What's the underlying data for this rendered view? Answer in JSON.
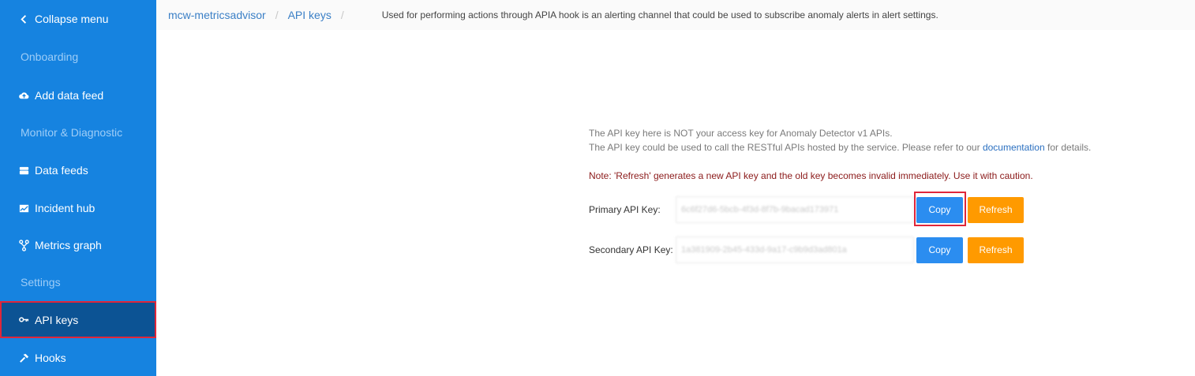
{
  "sidebar": {
    "collapse_label": "Collapse menu",
    "sections": {
      "onboarding": "Onboarding",
      "monitor": "Monitor & Diagnostic",
      "settings": "Settings"
    },
    "items": {
      "add_data_feed": "Add data feed",
      "data_feeds": "Data feeds",
      "incident_hub": "Incident hub",
      "metrics_graph": "Metrics graph",
      "api_keys": "API keys",
      "hooks": "Hooks"
    }
  },
  "header": {
    "breadcrumb_root": "mcw-metricsadvisor",
    "breadcrumb_current": "API keys",
    "description": "Used for performing actions through APIA hook is an alerting channel that could be used to subscribe anomaly alerts in alert settings."
  },
  "main": {
    "info_line_1": "The API key here is NOT your access key for Anomaly Detector v1 APIs.",
    "info_line_2_pre": "The API key could be used to call the RESTful APIs hosted by the service. Please refer to our ",
    "info_line_2_link": "documentation",
    "info_line_2_post": " for details.",
    "note": "Note: 'Refresh' generates a new API key and the old key becomes invalid immediately. Use it with caution.",
    "primary_label": "Primary API Key:",
    "primary_value": "6c6f27d6-5bcb-4f3d-8f7b-9bacad173971",
    "secondary_label": "Secondary API Key:",
    "secondary_value": "1a381909-2b45-433d-9a17-c9b9d3ad801a",
    "copy_label": "Copy",
    "refresh_label": "Refresh"
  }
}
